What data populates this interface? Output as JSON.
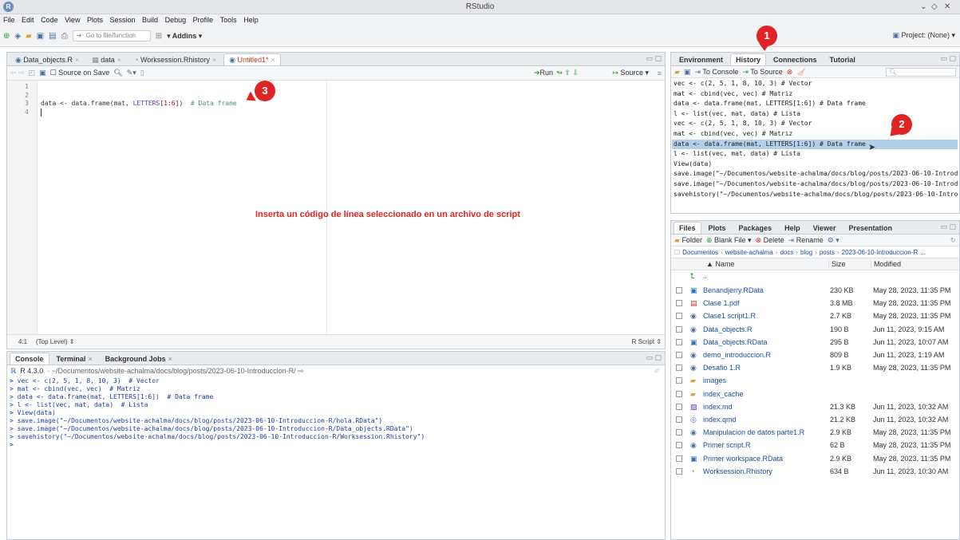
{
  "window": {
    "title": "RStudio",
    "controls": [
      "⌄",
      "◇",
      "✕"
    ]
  },
  "menu": [
    "File",
    "Edit",
    "Code",
    "View",
    "Plots",
    "Session",
    "Build",
    "Debug",
    "Profile",
    "Tools",
    "Help"
  ],
  "toolbar": {
    "goto_placeholder": "Go to file/function",
    "addins_label": "Addins",
    "project_label": "Project: (None)"
  },
  "editor": {
    "tabs": [
      {
        "label": "Data_objects.R",
        "active": false
      },
      {
        "label": "data",
        "active": false
      },
      {
        "label": "Worksession.Rhistory",
        "active": false
      },
      {
        "label": "Untitled1*",
        "active": true
      }
    ],
    "source_on_save": "Source on Save",
    "run_label": "Run",
    "source_label": "Source",
    "line_numbers": [
      "1",
      "2",
      "3",
      "4"
    ],
    "code": {
      "var": "data",
      "op": " <- ",
      "fn": "data.frame(mat, ",
      "letters": "LETTERS",
      "idx": "[",
      "n1": "1",
      "colon": ":",
      "n6": "6",
      "close": "])",
      "comment": "  # Data frame"
    },
    "cursor_pos": "4:1",
    "scope": "(Top Level)",
    "file_type": "R Script"
  },
  "annotation": {
    "text": "Inserta un código de línea seleccionado en un archivo de script",
    "badges": [
      "1",
      "2",
      "3"
    ]
  },
  "console": {
    "tabs": [
      "Console",
      "Terminal",
      "Background Jobs"
    ],
    "version": "R 4.3.0",
    "path": "~/Documentos/website-achalma/docs/blog/posts/2023-06-10-Introduccion-R/",
    "lines": [
      "> vec <- c(2, 5, 1, 8, 10, 3)  # Vector",
      "> mat <- cbind(vec, vec)  # Matriz",
      "> data <- data.frame(mat, LETTERS[1:6])  # Data frame",
      "> l <- list(vec, mat, data)  # Lista",
      "> View(data)",
      "> save.image(\"~/Documentos/website-achalma/docs/blog/posts/2023-06-10-Introduccion-R/hola.RData\")",
      "> save.image(\"~/Documentos/website-achalma/docs/blog/posts/2023-06-10-Introduccion-R/Data_objects.RData\")",
      "> savehistory(\"~/Documentos/website-achalma/docs/blog/posts/2023-06-10-Introduccion-R/Worksession.Rhistory\")",
      "> "
    ]
  },
  "history": {
    "tabs": [
      "Environment",
      "History",
      "Connections",
      "Tutorial"
    ],
    "active_tab": "History",
    "to_console": "To Console",
    "to_source": "To Source",
    "lines": [
      "vec <- c(2, 5, 1, 8, 10, 3) # Vector",
      "mat <- cbind(vec, vec) # Matriz",
      "data <- data.frame(mat, LETTERS[1:6]) # Data frame",
      "l <- list(vec, mat, data) # Lista",
      "vec <- c(2, 5, 1, 8, 10, 3) # Vector",
      "mat <- cbind(vec, vec) # Matriz",
      "data <- data.frame(mat, LETTERS[1:6]) # Data frame",
      "l <- list(vec, mat, data) # Lista",
      "View(data)",
      "save.image(\"~/Documentos/website-achalma/docs/blog/posts/2023-06-10-Introduccion-R/hola.RData\")",
      "save.image(\"~/Documentos/website-achalma/docs/blog/posts/2023-06-10-Introduccion-R/Data_objects.RData\")",
      "savehistory(\"~/Documentos/website-achalma/docs/blog/posts/2023-06-10-Introduccion-R/Worksession.Rhistory\")"
    ],
    "selected_index": 6
  },
  "files": {
    "tabs": [
      "Files",
      "Plots",
      "Packages",
      "Help",
      "Viewer",
      "Presentation"
    ],
    "toolbar": {
      "folder": "Folder",
      "blank_file": "Blank File",
      "delete": "Delete",
      "rename": "Rename"
    },
    "breadcrumb": [
      "Documentos",
      "website-achalma",
      "docs",
      "blog",
      "posts",
      "2023-06-10-Introduccion-R",
      "..."
    ],
    "columns": {
      "name": "▲ Name",
      "size": "Size",
      "modified": "Modified"
    },
    "parent": "..",
    "rows": [
      {
        "name": "Benandjerry.RData",
        "size": "230 KB",
        "modified": "May 28, 2023, 11:35 PM",
        "icon": "rdata-icon"
      },
      {
        "name": "Clase 1.pdf",
        "size": "3.8 MB",
        "modified": "May 28, 2023, 11:35 PM",
        "icon": "pdf-icon"
      },
      {
        "name": "Clase1 script1.R",
        "size": "2.7 KB",
        "modified": "May 28, 2023, 11:35 PM",
        "icon": "r-file-icon"
      },
      {
        "name": "Data_objects.R",
        "size": "190 B",
        "modified": "Jun 11, 2023, 9:15 AM",
        "icon": "r-file-icon"
      },
      {
        "name": "Data_objects.RData",
        "size": "295 B",
        "modified": "Jun 11, 2023, 10:07 AM",
        "icon": "rdata-icon"
      },
      {
        "name": "demo_introduccion.R",
        "size": "809 B",
        "modified": "Jun 11, 2023, 1:19 AM",
        "icon": "r-file-icon"
      },
      {
        "name": "Desafio 1.R",
        "size": "1.9 KB",
        "modified": "May 28, 2023, 11:35 PM",
        "icon": "r-file-icon"
      },
      {
        "name": "images",
        "size": "",
        "modified": "",
        "icon": "folder-icon"
      },
      {
        "name": "index_cache",
        "size": "",
        "modified": "",
        "icon": "folder-icon"
      },
      {
        "name": "index.md",
        "size": "21.3 KB",
        "modified": "Jun 11, 2023, 10:32 AM",
        "icon": "md-file-icon"
      },
      {
        "name": "index.qmd",
        "size": "21.2 KB",
        "modified": "Jun 11, 2023, 10:32 AM",
        "icon": "qmd-file-icon"
      },
      {
        "name": "Manipulacion de datos parte1.R",
        "size": "2.9 KB",
        "modified": "May 28, 2023, 11:35 PM",
        "icon": "r-file-icon"
      },
      {
        "name": "Primer script.R",
        "size": "62 B",
        "modified": "May 28, 2023, 11:35 PM",
        "icon": "r-file-icon"
      },
      {
        "name": "Primer workspace.RData",
        "size": "2.9 KB",
        "modified": "May 28, 2023, 11:35 PM",
        "icon": "rdata-icon"
      },
      {
        "name": "Worksession.Rhistory",
        "size": "634 B",
        "modified": "Jun 11, 2023, 10:30 AM",
        "icon": "history-file-icon"
      }
    ]
  },
  "colors": {
    "annotation_red": "#e02424",
    "selection": "#b4cfea",
    "link_blue": "#1a4fa3"
  }
}
